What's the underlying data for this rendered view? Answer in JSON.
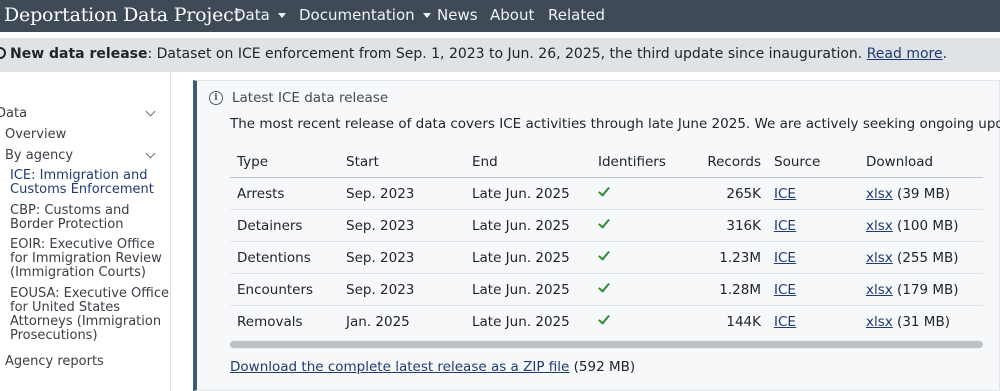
{
  "navbar": {
    "brand": "Deportation Data Project",
    "items": [
      {
        "label": "Data",
        "dropdown": true
      },
      {
        "label": "Documentation",
        "dropdown": true
      },
      {
        "label": "News",
        "dropdown": false
      },
      {
        "label": "About",
        "dropdown": false
      },
      {
        "label": "Related",
        "dropdown": false
      }
    ],
    "bg_color": "#3e4a56"
  },
  "announcement": {
    "bold": "New data release",
    "text": ": Dataset on ICE enforcement from Sep. 1, 2023 to Jun. 26, 2025, the third update since inauguration. ",
    "link": "Read more",
    "end": "."
  },
  "sidebar": {
    "data": "Data",
    "overview": "Overview",
    "by_agency": "By agency",
    "agencies": [
      {
        "lines": [
          "ICE: Immigration and",
          "Customs Enforcement"
        ],
        "active": true
      },
      {
        "lines": [
          "CBP: Customs and",
          "Border Protection"
        ],
        "active": false
      },
      {
        "lines": [
          "EOIR: Executive Office",
          "for Immigration Review",
          "(Immigration Courts)"
        ],
        "active": false
      },
      {
        "lines": [
          "EOUSA: Executive Office",
          "for United States",
          "Attorneys (Immigration",
          "Prosecutions)"
        ],
        "active": false
      }
    ],
    "agency_reports": "Agency reports"
  },
  "callout": {
    "title": "Latest ICE data release",
    "description": "The most recent release of data covers ICE activities through late June 2025. We are actively seeking ongoing updates.",
    "columns": [
      "Type",
      "Start",
      "End",
      "Identifiers",
      "Records",
      "Source",
      "Download"
    ],
    "rows": [
      {
        "type": "Arrests",
        "start": "Sep. 2023",
        "end": "Late Jun. 2025",
        "identifiers": true,
        "records": "265K",
        "source": "ICE",
        "download_link": "xlsx",
        "download_size": " (39 MB)"
      },
      {
        "type": "Detainers",
        "start": "Sep. 2023",
        "end": "Late Jun. 2025",
        "identifiers": true,
        "records": "316K",
        "source": "ICE",
        "download_link": "xlsx",
        "download_size": " (100 MB)"
      },
      {
        "type": "Detentions",
        "start": "Sep. 2023",
        "end": "Late Jun. 2025",
        "identifiers": true,
        "records": "1.23M",
        "source": "ICE",
        "download_link": "xlsx",
        "download_size": " (255 MB)"
      },
      {
        "type": "Encounters",
        "start": "Sep. 2023",
        "end": "Late Jun. 2025",
        "identifiers": true,
        "records": "1.28M",
        "source": "ICE",
        "download_link": "xlsx",
        "download_size": " (179 MB)"
      },
      {
        "type": "Removals",
        "start": "Jan. 2025",
        "end": "Late Jun. 2025",
        "identifiers": true,
        "records": "144K",
        "source": "ICE",
        "download_link": "xlsx",
        "download_size": " (31 MB)"
      }
    ],
    "zip_link": "Download the complete latest release as a ZIP file",
    "zip_size": " (592 MB)",
    "accent_color": "#3e5a78",
    "check_color": "#2e8b3a"
  }
}
